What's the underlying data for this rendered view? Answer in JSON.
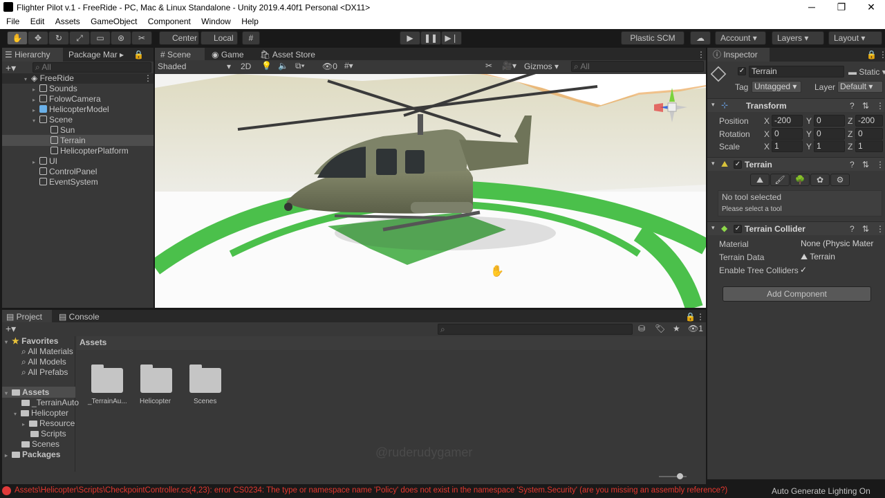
{
  "window": {
    "title": "Flighter Pilot v.1 - FreeRide - PC, Mac & Linux Standalone - Unity 2019.4.40f1 Personal <DX11>",
    "minimize": "─",
    "maximize": "❐",
    "close": "✕"
  },
  "menu": [
    "File",
    "Edit",
    "Assets",
    "GameObject",
    "Component",
    "Window",
    "Help"
  ],
  "toolbar": {
    "pivot": "Center",
    "space": "Local",
    "plastic": "Plastic SCM",
    "account": "Account",
    "layers": "Layers",
    "layout": "Layout"
  },
  "hierarchy": {
    "tab": "Hierarchy",
    "tab2": "Package Mar",
    "search_placeholder": "All",
    "items": [
      {
        "label": "FreeRide"
      },
      {
        "label": "Sounds"
      },
      {
        "label": "FolowCamera"
      },
      {
        "label": "HelicopterModel"
      },
      {
        "label": "Scene"
      },
      {
        "label": "Sun"
      },
      {
        "label": "Terrain"
      },
      {
        "label": "HelicopterPlatform"
      },
      {
        "label": "UI"
      },
      {
        "label": "ControlPanel"
      },
      {
        "label": "EventSystem"
      }
    ]
  },
  "scene": {
    "tabs": [
      "Scene",
      "Game",
      "Asset Store"
    ],
    "shading": "Shaded",
    "mode2d": "2D",
    "hidden_count": "0",
    "gizmos": "Gizmos",
    "search_placeholder": "All"
  },
  "inspector": {
    "tab": "Inspector",
    "object_name": "Terrain",
    "static": "Static",
    "tag_label": "Tag",
    "tag_value": "Untagged",
    "layer_label": "Layer",
    "layer_value": "Default",
    "transform": {
      "title": "Transform",
      "position_label": "Position",
      "rotation_label": "Rotation",
      "scale_label": "Scale",
      "axis_x": "X",
      "axis_y": "Y",
      "axis_z": "Z",
      "position": [
        "-200",
        "0",
        "-200"
      ],
      "rotation": [
        "0",
        "0",
        "0"
      ],
      "scale": [
        "1",
        "1",
        "1"
      ]
    },
    "terrain": {
      "title": "Terrain",
      "no_tool": "No tool selected",
      "hint": "Please select a tool"
    },
    "collider": {
      "title": "Terrain Collider",
      "material_label": "Material",
      "material_value": "None (Physic Mater",
      "data_label": "Terrain Data",
      "data_value": "Terrain",
      "trees_label": "Enable Tree Colliders"
    },
    "add_component": "Add Component"
  },
  "project": {
    "tabs": [
      "Project",
      "Console"
    ],
    "hidden_count": "1",
    "breadcrumb": "Assets",
    "favorites": {
      "title": "Favorites",
      "items": [
        "All Materials",
        "All Models",
        "All Prefabs"
      ]
    },
    "assets_tree": {
      "title": "Assets",
      "items": [
        "_TerrainAuto",
        "Helicopter",
        "Resource",
        "Scripts",
        "Scenes"
      ],
      "packages": "Packages"
    },
    "grid": [
      "_TerrainAu...",
      "Helicopter",
      "Scenes"
    ],
    "watermark": "@ruderudygamer"
  },
  "status": {
    "error": "Assets\\Helicopter\\Scripts\\CheckpointController.cs(4,23): error CS0234: The type or namespace name 'Policy' does not exist in the namespace 'System.Security' (are you missing an assembly reference?)",
    "lighting": "Auto Generate Lighting On"
  }
}
